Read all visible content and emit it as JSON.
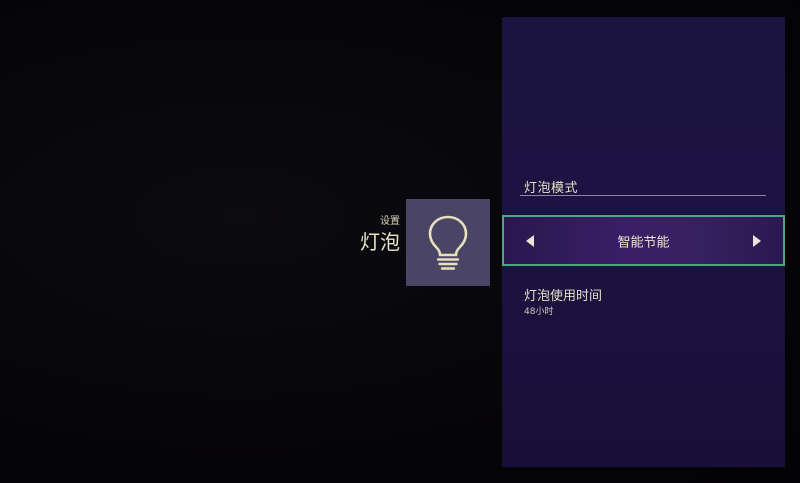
{
  "heading": {
    "subtitle": "设置",
    "title": "灯泡"
  },
  "tile": {
    "icon": "lightbulb-icon",
    "icon_color": "#e8e0bc",
    "background": "#4a4565"
  },
  "panel": {
    "section_title": "灯泡模式",
    "mode_selector": {
      "value": "智能节能",
      "left_arrow": "◀",
      "right_arrow": "▶"
    },
    "usage": {
      "title": "灯泡使用时间",
      "value": "48小时"
    },
    "colors": {
      "panel_bg": "#1d1342",
      "focus_border": "#4ea87e"
    }
  }
}
